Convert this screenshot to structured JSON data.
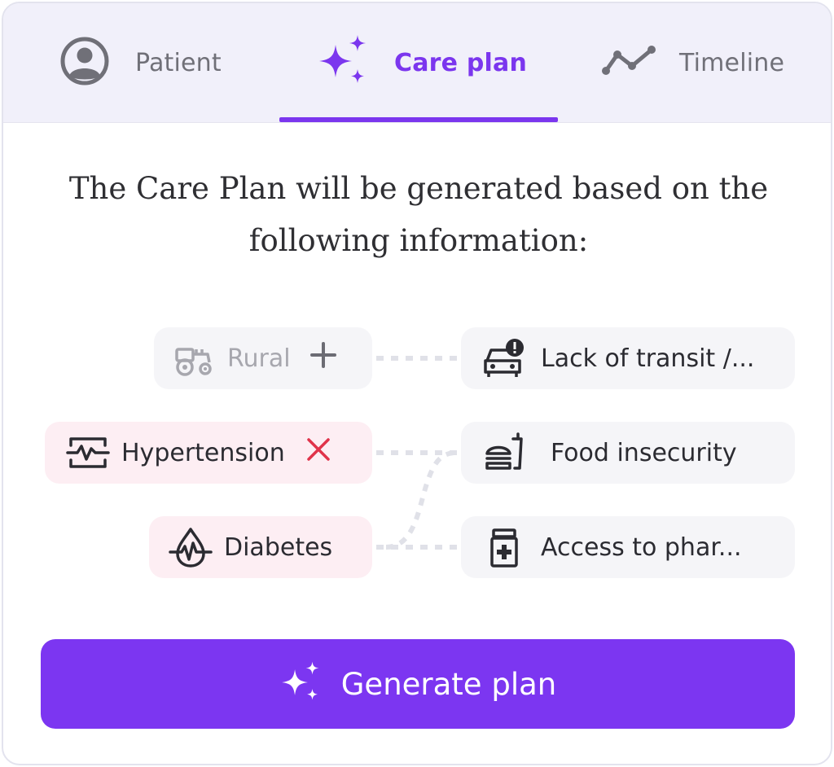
{
  "tabs": [
    {
      "label": "Patient",
      "icon": "user-circle-icon",
      "active": false
    },
    {
      "label": "Care plan",
      "icon": "sparkles-icon",
      "active": true
    },
    {
      "label": "Timeline",
      "icon": "timeline-icon",
      "active": false
    }
  ],
  "intro": {
    "line1": "The Care Plan will be generated based on the",
    "line2": "following information:"
  },
  "left_items": [
    {
      "label": "Rural",
      "icon": "tractor-icon",
      "action": "add",
      "action_icon": "plus-icon",
      "state": "disabled"
    },
    {
      "label": "Hypertension",
      "icon": "heart-monitor-icon",
      "action": "remove",
      "action_icon": "close-icon",
      "state": "selected"
    },
    {
      "label": "Diabetes",
      "icon": "blood-drop-pulse-icon",
      "state": "selected"
    }
  ],
  "right_items": [
    {
      "label": "Lack of transit /...",
      "icon": "car-alert-icon"
    },
    {
      "label": "Food insecurity",
      "icon": "food-icon"
    },
    {
      "label": "Access to phar...",
      "icon": "medicine-bottle-icon"
    }
  ],
  "generate_button": {
    "label": "Generate plan",
    "icon": "sparkles-icon"
  },
  "colors": {
    "accent": "#7b36ee",
    "button": "#7c36f1",
    "selected_pill": "#fdeef3",
    "neutral_pill": "#f5f5f8",
    "remove_x": "#e0334a",
    "tabbar": "#f1f0fa"
  }
}
